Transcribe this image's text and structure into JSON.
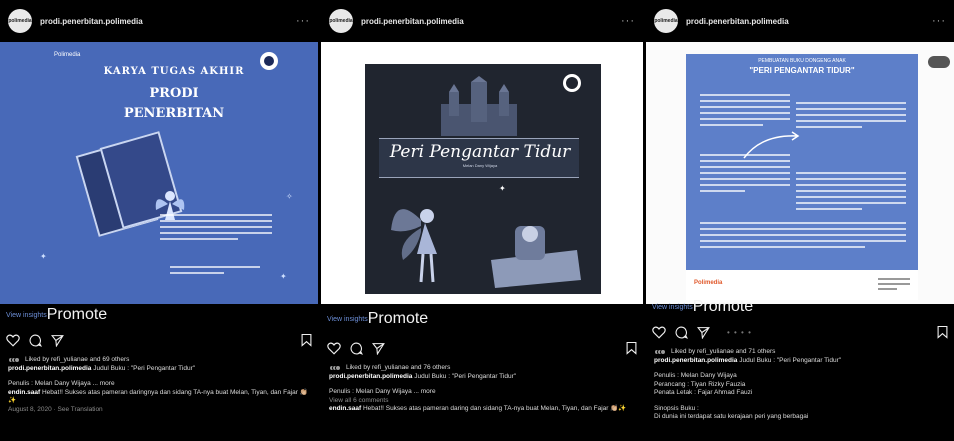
{
  "posts": [
    {
      "username": "prodi.penerbitan.polimedia",
      "avatar_text": "polimedia",
      "more": "···",
      "poster": {
        "logo": "Polimedia",
        "line1": "KARYA TUGAS AKHIR",
        "line2": "PRODI",
        "line3": "PENERBITAN"
      },
      "view_insights": "View insights",
      "promote": "Promote",
      "likes_text": "Liked by refi_yulianae and 69 others",
      "caption_user": "prodi.penerbitan.polimedia",
      "caption_text": "Judul Buku : \"Peri Pengantar Tidur\"",
      "line1": "Penulis : Melan Dany Wijaya ... more",
      "comment_user": "endin.saaf",
      "comment_text": "Hebat!! Sukses atas pameran daringnya dan sidang TA-nya buat Melan, Tiyan, dan Fajar 👏🏼✨",
      "time": "August 8, 2020 · See Translation"
    },
    {
      "username": "prodi.penerbitan.polimedia",
      "avatar_text": "polimedia",
      "more": "···",
      "poster": {
        "title": "Peri Pengantar Tidur",
        "author": "Melan Dany Wijaya"
      },
      "view_insights": "View insights",
      "promote": "Promote",
      "likes_text": "Liked by refi_yulianae and 76 others",
      "caption_user": "prodi.penerbitan.polimedia",
      "caption_text": "Judul Buku : \"Peri Pengantar Tidur\"",
      "line1": "Penulis : Melan Dany Wijaya ... more",
      "view_comments": "View all 6 comments",
      "comment_user": "endin.saaf",
      "comment_text": "Hebat!! Sukses atas pameran daring dan sidang TA-nya buat Melan, Tiyan, dan Fajar 👏🏼✨"
    },
    {
      "username": "prodi.penerbitan.polimedia",
      "avatar_text": "polimedia",
      "more": "···",
      "poster": {
        "head1": "PEMBUATAN BUKU DONGENG ANAK",
        "head2": "\"PERI PENGANTAR TIDUR\"",
        "footer_logo": "Polimedia"
      },
      "view_insights": "View insights",
      "promote": "Promote",
      "likes_text": "Liked by refi_yulianae and 71 others",
      "caption_user": "prodi.penerbitan.polimedia",
      "caption_text": "Judul Buku : \"Peri Pengantar Tidur\"",
      "line1": "Penulis : Melan Dany Wijaya",
      "line2": "Perancang : Tiyan Rizky Fauzia",
      "line3": "Penata Letak : Fajar Ahmad Fauzi",
      "line4": "Sinopsis Buku :",
      "line5": "Di dunia ini terdapat satu kerajaan peri yang berbagai"
    }
  ],
  "colors": {
    "promote": "#2a7bd8",
    "link": "#6d8fd8",
    "poster_blue": "#4869b8"
  }
}
